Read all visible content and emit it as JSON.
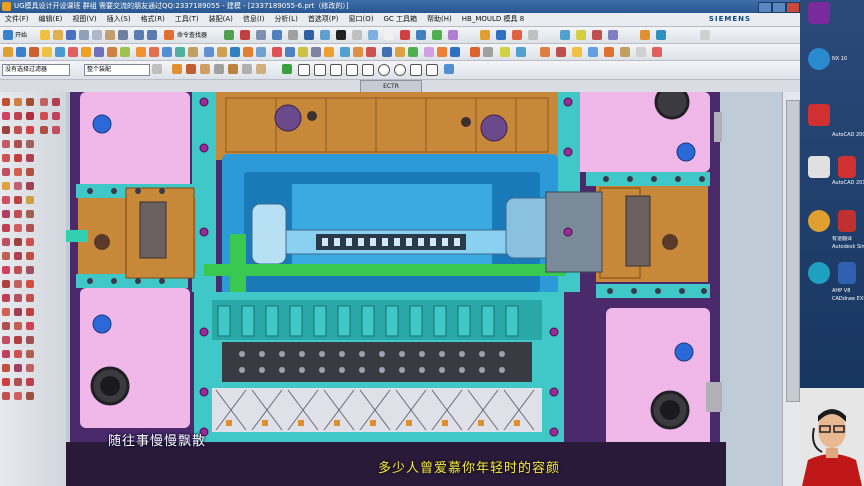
{
  "window": {
    "title": "UG模具设计开设课班 群组 需要交流的朋友通过QQ:2337189055 - 建模 - [2337189055-6.prt（修改的）]",
    "brand": "SIEMENS"
  },
  "menu": {
    "items": [
      "文件(F)",
      "编辑(E)",
      "视图(V)",
      "插入(S)",
      "格式(R)",
      "工具(T)",
      "装配(A)",
      "信息(I)",
      "分析(L)",
      "首选项(P)",
      "窗口(O)",
      "GC 工具箱",
      "帮助(H)",
      "HB_MOULD 模具 8"
    ]
  },
  "toolbar": {
    "start_label": "开始",
    "assembly_nav_label": "命令查找器",
    "selection_filter": "整个装配",
    "selection_scope": "没有选择过滤器"
  },
  "part_name": "ECTR",
  "subtitles": {
    "line1": "随往事慢慢飘散",
    "line2": "多少人曾爱慕你年轻时的容颜"
  },
  "desktop_icons": [
    {
      "label": "",
      "color": "#7a2a9a"
    },
    {
      "label": "NX 10",
      "color": "#2a8ad0"
    },
    {
      "label": "AutoCAD 2008",
      "color": "#d03030"
    },
    {
      "label": "",
      "color": "#e0e0e0"
    },
    {
      "label": "AutoCAD 2016",
      "color": "#d03030"
    },
    {
      "label": "有道翻译",
      "color": "#e0a030"
    },
    {
      "label": "Autodesk Simulation",
      "color": "#c03030"
    },
    {
      "label": "",
      "color": "#3080d0"
    },
    {
      "label": "AHP V8",
      "color": "#20a0c0"
    },
    {
      "label": "CADdraw EXE",
      "color": "#3060b0"
    }
  ],
  "colors": {
    "plate_pink": "#f0b8e8",
    "cavity_orange": "#c8883a",
    "insert_blue": "#2c9ad8",
    "cyan_block": "#40c8c8",
    "green": "#3ac850",
    "dark_purple": "#4a2a6a"
  }
}
